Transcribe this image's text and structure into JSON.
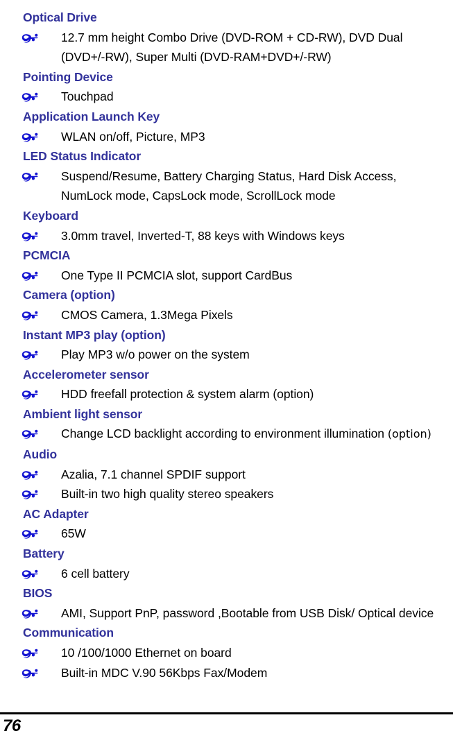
{
  "document": {
    "page_number": "76",
    "heading_color": "#32329b",
    "bullet_color": "#1414d2",
    "body_color": "#000000",
    "bullet_icon": "curly-loop-bullet"
  },
  "sections": [
    {
      "heading": "Optical Drive",
      "bullets": [
        "12.7 mm height Combo Drive (DVD-ROM + CD-RW), DVD Dual (DVD+/-RW), Super Multi (DVD-RAM+DVD+/-RW)"
      ]
    },
    {
      "heading": "Pointing Device",
      "bullets": [
        "Touchpad"
      ]
    },
    {
      "heading": "Application Launch Key",
      "bullets": [
        "WLAN on/off, Picture, MP3"
      ]
    },
    {
      "heading": "LED Status Indicator",
      "bullets": [
        "Suspend/Resume, Battery Charging Status, Hard Disk Access, NumLock mode, CapsLock mode, ScrollLock mode"
      ]
    },
    {
      "heading": "Keyboard",
      "bullets": [
        "3.0mm travel, Inverted-T, 88 keys with Windows keys"
      ]
    },
    {
      "heading": "PCMCIA",
      "bullets": [
        "One Type II PCMCIA slot, support CardBus"
      ]
    },
    {
      "heading": "Camera (option)",
      "bullets": [
        "CMOS Camera, 1.3Mega Pixels"
      ]
    },
    {
      "heading": "Instant MP3 play (option)",
      "bullets": [
        "Play MP3 w/o power on the system"
      ]
    },
    {
      "heading": "Accelerometer sensor",
      "bullets": [
        "HDD freefall protection & system alarm (option)"
      ]
    },
    {
      "heading": "Ambient light sensor",
      "bullets": [
        "Change LCD backlight according to environment illumination "
      ],
      "bullet_suffix": "(option)"
    },
    {
      "heading": "Audio",
      "bullets": [
        "Azalia, 7.1 channel SPDIF support",
        "Built-in two high quality stereo speakers"
      ]
    },
    {
      "heading": "AC Adapter",
      "bullets": [
        "65W"
      ]
    },
    {
      "heading": "Battery",
      "bullets": [
        "6 cell battery"
      ]
    },
    {
      "heading": "BIOS",
      "bullets": [
        "AMI, Support PnP, password ,Bootable from USB Disk/ Optical device"
      ]
    },
    {
      "heading": "Communication",
      "bullets": [
        "10 /100/1000 Ethernet on board",
        "Built-in MDC V.90 56Kbps Fax/Modem"
      ]
    }
  ]
}
